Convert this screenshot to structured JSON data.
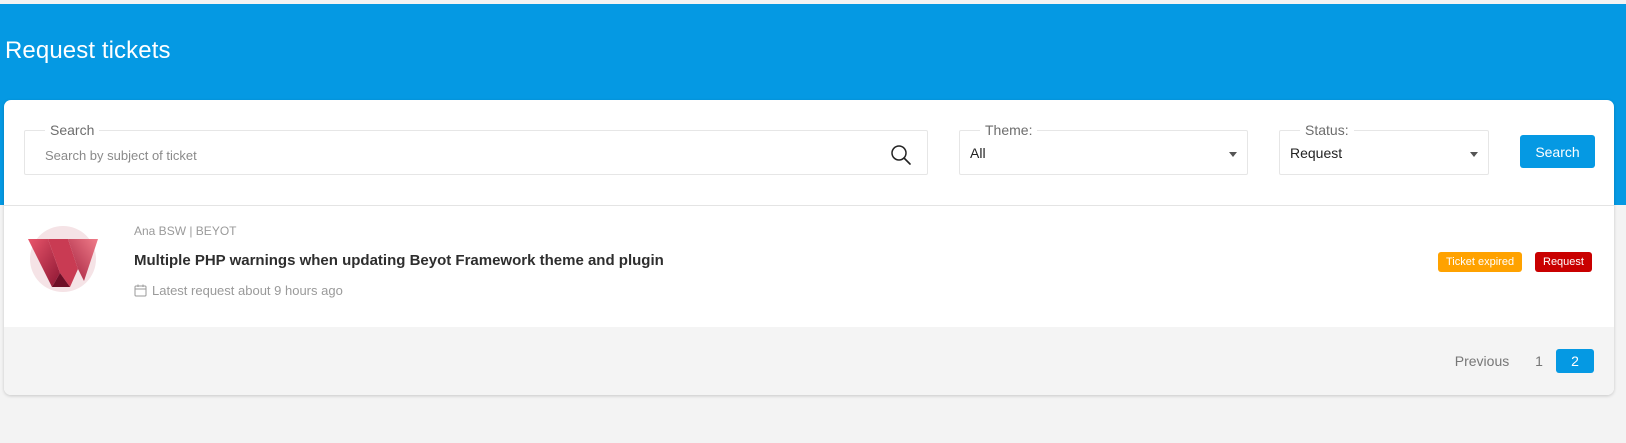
{
  "page": {
    "title": "Request tickets"
  },
  "colors": {
    "primary": "#0599e3",
    "expired_badge": "#ffa200",
    "status_badge": "#c90000"
  },
  "filters": {
    "search": {
      "legend": "Search",
      "placeholder": "Search by subject of ticket",
      "value": "",
      "icon": "search-icon"
    },
    "theme": {
      "legend": "Theme:",
      "selected": "All"
    },
    "status": {
      "legend": "Status:",
      "selected": "Request"
    },
    "search_button": "Search"
  },
  "tickets": [
    {
      "author": "Ana BSW | BEYOT",
      "title": "Multiple PHP warnings when updating Beyot Framework theme and plugin",
      "meta": "Latest request about 9 hours ago",
      "meta_icon": "calendar-icon",
      "badges": [
        "Ticket expired",
        "Request"
      ]
    }
  ],
  "pagination": {
    "previous": "Previous",
    "pages": [
      "1",
      "2"
    ],
    "current": "2"
  }
}
